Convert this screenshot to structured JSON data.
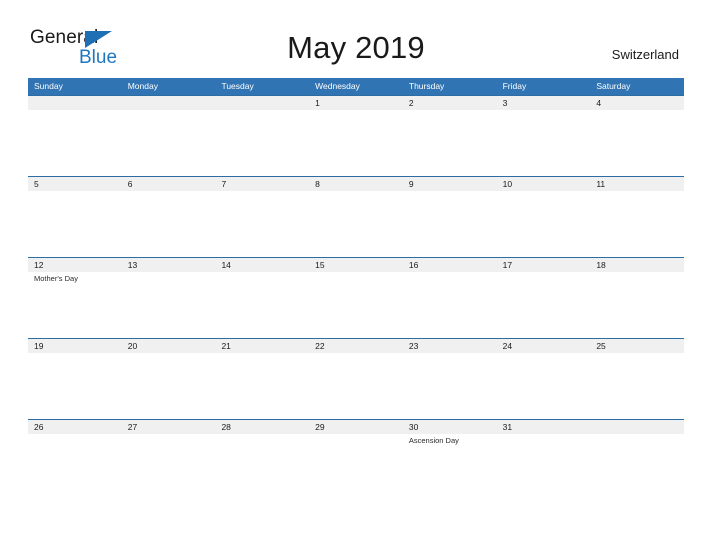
{
  "header": {
    "logo": {
      "word_one": "General",
      "word_two": "Blue",
      "triangle_icon": "triangle-right-icon",
      "triangle_color": "#1f6fb5",
      "blue_text_color": "#1f77c0"
    },
    "title": "May 2019",
    "location": "Switzerland"
  },
  "calendar": {
    "header_background": "#3174b4",
    "date_band_background": "#f0f0f0",
    "row_border_color": "#2e6da4",
    "weekdays": [
      "Sunday",
      "Monday",
      "Tuesday",
      "Wednesday",
      "Thursday",
      "Friday",
      "Saturday"
    ],
    "weeks": [
      {
        "days": [
          {
            "date": "",
            "event": ""
          },
          {
            "date": "",
            "event": ""
          },
          {
            "date": "",
            "event": ""
          },
          {
            "date": "1",
            "event": ""
          },
          {
            "date": "2",
            "event": ""
          },
          {
            "date": "3",
            "event": ""
          },
          {
            "date": "4",
            "event": ""
          }
        ]
      },
      {
        "days": [
          {
            "date": "5",
            "event": ""
          },
          {
            "date": "6",
            "event": ""
          },
          {
            "date": "7",
            "event": ""
          },
          {
            "date": "8",
            "event": ""
          },
          {
            "date": "9",
            "event": ""
          },
          {
            "date": "10",
            "event": ""
          },
          {
            "date": "11",
            "event": ""
          }
        ]
      },
      {
        "days": [
          {
            "date": "12",
            "event": "Mother's Day"
          },
          {
            "date": "13",
            "event": ""
          },
          {
            "date": "14",
            "event": ""
          },
          {
            "date": "15",
            "event": ""
          },
          {
            "date": "16",
            "event": ""
          },
          {
            "date": "17",
            "event": ""
          },
          {
            "date": "18",
            "event": ""
          }
        ]
      },
      {
        "days": [
          {
            "date": "19",
            "event": ""
          },
          {
            "date": "20",
            "event": ""
          },
          {
            "date": "21",
            "event": ""
          },
          {
            "date": "22",
            "event": ""
          },
          {
            "date": "23",
            "event": ""
          },
          {
            "date": "24",
            "event": ""
          },
          {
            "date": "25",
            "event": ""
          }
        ]
      },
      {
        "days": [
          {
            "date": "26",
            "event": ""
          },
          {
            "date": "27",
            "event": ""
          },
          {
            "date": "28",
            "event": ""
          },
          {
            "date": "29",
            "event": ""
          },
          {
            "date": "30",
            "event": "Ascension Day"
          },
          {
            "date": "31",
            "event": ""
          },
          {
            "date": "",
            "event": ""
          }
        ]
      }
    ]
  }
}
